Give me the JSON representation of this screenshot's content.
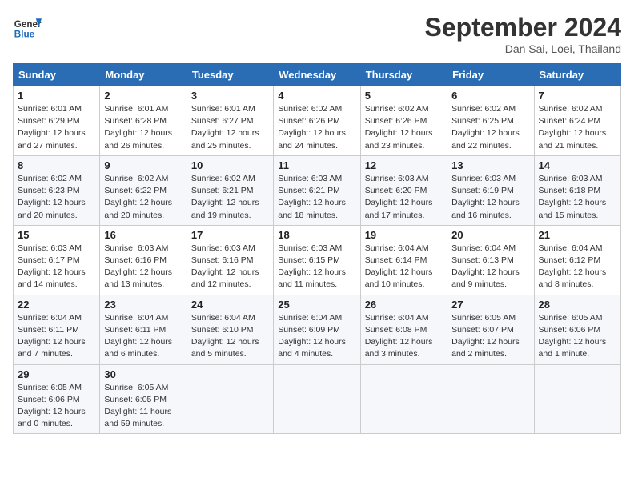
{
  "header": {
    "logo_general": "General",
    "logo_blue": "Blue",
    "month_title": "September 2024",
    "location": "Dan Sai, Loei, Thailand"
  },
  "weekdays": [
    "Sunday",
    "Monday",
    "Tuesday",
    "Wednesday",
    "Thursday",
    "Friday",
    "Saturday"
  ],
  "weeks": [
    [
      {
        "day": "1",
        "sunrise": "6:01 AM",
        "sunset": "6:29 PM",
        "daylight": "12 hours and 27 minutes."
      },
      {
        "day": "2",
        "sunrise": "6:01 AM",
        "sunset": "6:28 PM",
        "daylight": "12 hours and 26 minutes."
      },
      {
        "day": "3",
        "sunrise": "6:01 AM",
        "sunset": "6:27 PM",
        "daylight": "12 hours and 25 minutes."
      },
      {
        "day": "4",
        "sunrise": "6:02 AM",
        "sunset": "6:26 PM",
        "daylight": "12 hours and 24 minutes."
      },
      {
        "day": "5",
        "sunrise": "6:02 AM",
        "sunset": "6:26 PM",
        "daylight": "12 hours and 23 minutes."
      },
      {
        "day": "6",
        "sunrise": "6:02 AM",
        "sunset": "6:25 PM",
        "daylight": "12 hours and 22 minutes."
      },
      {
        "day": "7",
        "sunrise": "6:02 AM",
        "sunset": "6:24 PM",
        "daylight": "12 hours and 21 minutes."
      }
    ],
    [
      {
        "day": "8",
        "sunrise": "6:02 AM",
        "sunset": "6:23 PM",
        "daylight": "12 hours and 20 minutes."
      },
      {
        "day": "9",
        "sunrise": "6:02 AM",
        "sunset": "6:22 PM",
        "daylight": "12 hours and 20 minutes."
      },
      {
        "day": "10",
        "sunrise": "6:02 AM",
        "sunset": "6:21 PM",
        "daylight": "12 hours and 19 minutes."
      },
      {
        "day": "11",
        "sunrise": "6:03 AM",
        "sunset": "6:21 PM",
        "daylight": "12 hours and 18 minutes."
      },
      {
        "day": "12",
        "sunrise": "6:03 AM",
        "sunset": "6:20 PM",
        "daylight": "12 hours and 17 minutes."
      },
      {
        "day": "13",
        "sunrise": "6:03 AM",
        "sunset": "6:19 PM",
        "daylight": "12 hours and 16 minutes."
      },
      {
        "day": "14",
        "sunrise": "6:03 AM",
        "sunset": "6:18 PM",
        "daylight": "12 hours and 15 minutes."
      }
    ],
    [
      {
        "day": "15",
        "sunrise": "6:03 AM",
        "sunset": "6:17 PM",
        "daylight": "12 hours and 14 minutes."
      },
      {
        "day": "16",
        "sunrise": "6:03 AM",
        "sunset": "6:16 PM",
        "daylight": "12 hours and 13 minutes."
      },
      {
        "day": "17",
        "sunrise": "6:03 AM",
        "sunset": "6:16 PM",
        "daylight": "12 hours and 12 minutes."
      },
      {
        "day": "18",
        "sunrise": "6:03 AM",
        "sunset": "6:15 PM",
        "daylight": "12 hours and 11 minutes."
      },
      {
        "day": "19",
        "sunrise": "6:04 AM",
        "sunset": "6:14 PM",
        "daylight": "12 hours and 10 minutes."
      },
      {
        "day": "20",
        "sunrise": "6:04 AM",
        "sunset": "6:13 PM",
        "daylight": "12 hours and 9 minutes."
      },
      {
        "day": "21",
        "sunrise": "6:04 AM",
        "sunset": "6:12 PM",
        "daylight": "12 hours and 8 minutes."
      }
    ],
    [
      {
        "day": "22",
        "sunrise": "6:04 AM",
        "sunset": "6:11 PM",
        "daylight": "12 hours and 7 minutes."
      },
      {
        "day": "23",
        "sunrise": "6:04 AM",
        "sunset": "6:11 PM",
        "daylight": "12 hours and 6 minutes."
      },
      {
        "day": "24",
        "sunrise": "6:04 AM",
        "sunset": "6:10 PM",
        "daylight": "12 hours and 5 minutes."
      },
      {
        "day": "25",
        "sunrise": "6:04 AM",
        "sunset": "6:09 PM",
        "daylight": "12 hours and 4 minutes."
      },
      {
        "day": "26",
        "sunrise": "6:04 AM",
        "sunset": "6:08 PM",
        "daylight": "12 hours and 3 minutes."
      },
      {
        "day": "27",
        "sunrise": "6:05 AM",
        "sunset": "6:07 PM",
        "daylight": "12 hours and 2 minutes."
      },
      {
        "day": "28",
        "sunrise": "6:05 AM",
        "sunset": "6:06 PM",
        "daylight": "12 hours and 1 minute."
      }
    ],
    [
      {
        "day": "29",
        "sunrise": "6:05 AM",
        "sunset": "6:06 PM",
        "daylight": "12 hours and 0 minutes."
      },
      {
        "day": "30",
        "sunrise": "6:05 AM",
        "sunset": "6:05 PM",
        "daylight": "11 hours and 59 minutes."
      },
      null,
      null,
      null,
      null,
      null
    ]
  ],
  "labels": {
    "sunrise": "Sunrise:",
    "sunset": "Sunset:",
    "daylight": "Daylight:"
  }
}
